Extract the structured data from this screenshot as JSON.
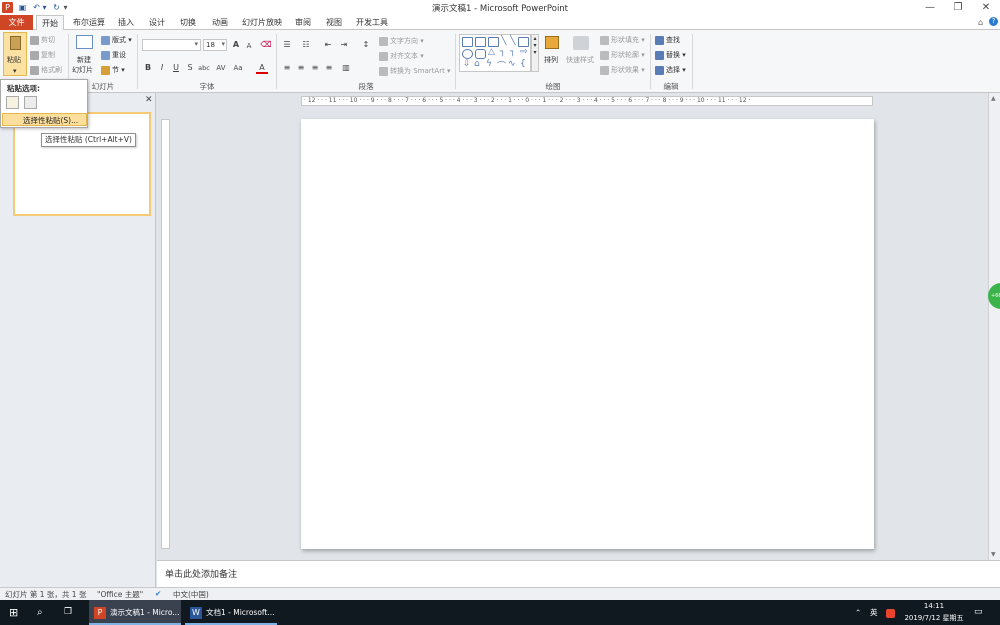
{
  "window": {
    "title": "演示文稿1 - Microsoft PowerPoint",
    "controls": [
      "minimize",
      "restore",
      "close"
    ]
  },
  "tabs": [
    {
      "label": "文件"
    },
    {
      "label": "开始"
    },
    {
      "label": "布尔运算"
    },
    {
      "label": "插入"
    },
    {
      "label": "设计"
    },
    {
      "label": "切换"
    },
    {
      "label": "动画"
    },
    {
      "label": "幻灯片放映"
    },
    {
      "label": "审阅"
    },
    {
      "label": "视图"
    },
    {
      "label": "开发工具"
    }
  ],
  "ribbon": {
    "clipboard": {
      "paste": "粘贴",
      "cut": "剪切",
      "copy": "复制",
      "format_painter": "格式刷",
      "group": "剪贴板"
    },
    "slides": {
      "new_slide_1": "新建",
      "new_slide_2": "幻灯片",
      "layout": "版式",
      "reset": "重设",
      "section": "节",
      "group": "幻灯片"
    },
    "font": {
      "size": "18",
      "group": "字体",
      "bold": "B",
      "italic": "I",
      "underline": "U",
      "strike": "S",
      "shadow": "abc",
      "spacing": "AV",
      "case": "Aa",
      "grow": "A",
      "shrink": "A",
      "color": "A"
    },
    "paragraph": {
      "text_direction": "文字方向",
      "align_text": "对齐文本",
      "smartart": "转换为 SmartArt",
      "group": "段落"
    },
    "drawing": {
      "arrange": "排列",
      "quick_styles": "快速样式",
      "fill": "形状填充",
      "outline": "形状轮廓",
      "effects": "形状效果",
      "group": "绘图"
    },
    "editing": {
      "find": "查找",
      "replace": "替换",
      "select": "选择",
      "group": "编辑"
    }
  },
  "paste_menu": {
    "header": "粘贴选项:",
    "item": "选择性粘贴(S)...",
    "tooltip": "选择性粘贴 (Ctrl+Alt+V)"
  },
  "ruler": {
    "labels": "· 12 · · · 11 · · · 10 · · · 9 · · · 8 · · · 7 · · · 6 · · · 5 · · · 4 · · · 3 · · · 2 · · · 1 · · · 0 · · · 1 · · · 2 · · · 3 · · · 4 · · · 5 · · · 6 · · · 7 · · · 8 · · · 9 · · · 10 · · · 11 · · · 12 ·"
  },
  "side_button": "+66",
  "notes": {
    "placeholder": "单击此处添加备注"
  },
  "statusbar": {
    "slide_info": "幻灯片 第 1 张，共 1 张",
    "theme": "\"Office 主题\"",
    "language": "中文(中国)"
  },
  "taskbar": {
    "ppt": "演示文稿1 - Micro...",
    "word": "文档1 - Microsoft...",
    "ime": "英",
    "time": "14:11",
    "date": "2019/7/12 星期五"
  },
  "colors": {
    "file_tab": "#d04525",
    "accent": "#2b579a",
    "selection": "#f6c977",
    "green": "#3bb54a"
  }
}
